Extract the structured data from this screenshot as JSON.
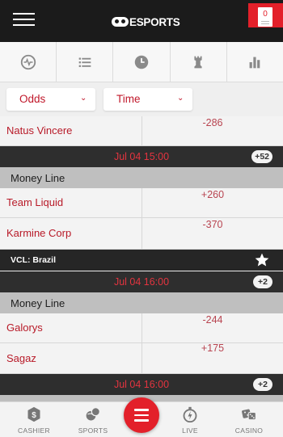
{
  "header": {
    "logo_text": "ESPORTS",
    "betslip_count": "0",
    "colors": {
      "background": "#1b1b1b",
      "accent": "#e3202a"
    }
  },
  "tabs": [
    {
      "icon": "live-pulse-icon"
    },
    {
      "icon": "list-icon"
    },
    {
      "icon": "clock-icon"
    },
    {
      "icon": "chess-rook-icon"
    },
    {
      "icon": "bar-chart-icon"
    }
  ],
  "filters": {
    "odds": "Odds",
    "time": "Time"
  },
  "events": {
    "partial": {
      "team": "Natus Vincere",
      "odds": "-286"
    },
    "event1": {
      "date": "Jul 04 15:00",
      "more": "+52",
      "market": "Money Line",
      "teams": [
        {
          "name": "Team Liquid",
          "odds": "+260"
        },
        {
          "name": "Karmine Corp",
          "odds": "-370"
        }
      ]
    },
    "league": {
      "name": "VCL: Brazil"
    },
    "event2": {
      "date": "Jul 04 16:00",
      "more": "+2",
      "market": "Money Line",
      "teams": [
        {
          "name": "Galorys",
          "odds": "-244"
        },
        {
          "name": "Sagaz",
          "odds": "+175"
        }
      ]
    },
    "event3": {
      "date": "Jul 04 16:00",
      "more": "+2"
    }
  },
  "bottom_nav": {
    "cashier": "CASHIER",
    "sports": "SPORTS",
    "live": "LIVE",
    "casino": "CASINO"
  }
}
